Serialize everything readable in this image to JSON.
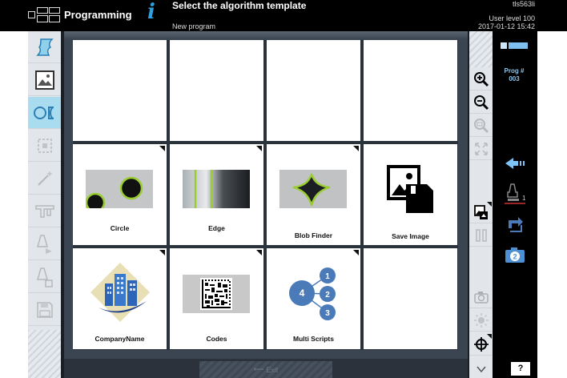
{
  "header": {
    "app_title": "Programming",
    "page_title": "Select the algorithm template",
    "page_subtitle": "New program",
    "device_name": "tls563li",
    "user_level": "User level 100",
    "datetime": "2017-01-12 15:42",
    "info_icon": "i"
  },
  "left_toolbar": {
    "items": [
      {
        "name": "program-icon",
        "state": "normal"
      },
      {
        "name": "image-icon",
        "state": "normal"
      },
      {
        "name": "shape-tools-icon",
        "state": "active"
      },
      {
        "name": "region-icon",
        "state": "disabled"
      },
      {
        "name": "magic-wand-icon",
        "state": "disabled"
      },
      {
        "name": "caliper-icon",
        "state": "disabled"
      },
      {
        "name": "tool-flow-icon",
        "state": "disabled"
      },
      {
        "name": "tool-branch-icon",
        "state": "disabled"
      },
      {
        "name": "save-icon",
        "state": "disabled"
      }
    ]
  },
  "templates": [
    {
      "label": "",
      "icon": "",
      "has_menu": false
    },
    {
      "label": "",
      "icon": "",
      "has_menu": false
    },
    {
      "label": "",
      "icon": "",
      "has_menu": false
    },
    {
      "label": "",
      "icon": "",
      "has_menu": false
    },
    {
      "label": "Circle",
      "icon": "circle-template-icon",
      "has_menu": true
    },
    {
      "label": "Edge",
      "icon": "edge-template-icon",
      "has_menu": true
    },
    {
      "label": "Blob Finder",
      "icon": "blob-template-icon",
      "has_menu": true
    },
    {
      "label": "Save Image",
      "icon": "save-image-icon",
      "has_menu": false
    },
    {
      "label": "CompanyName",
      "icon": "company-logo-icon",
      "has_menu": true
    },
    {
      "label": "Codes",
      "icon": "datamatrix-icon",
      "has_menu": true
    },
    {
      "label": "Multi Scripts",
      "icon": "multi-scripts-icon",
      "has_menu": true
    },
    {
      "label": "",
      "icon": "",
      "has_menu": false
    }
  ],
  "multi_scripts_numbers": [
    "4",
    "1",
    "2",
    "3"
  ],
  "bottom": {
    "exit_label": "Exit"
  },
  "right_toolbar": {
    "items": [
      "zoom-in-icon",
      "zoom-out-icon",
      "zoom-fit-icon",
      "fullscreen-icon",
      "image-swap-icon",
      "pause-icon",
      "camera-settings-icon",
      "brightness-icon",
      "crosshair-icon",
      "scroll-down-icon"
    ]
  },
  "far_right": {
    "prog_label": "Prog #",
    "prog_number": "003",
    "trigger_count": "1",
    "camera_number": "2",
    "help_label": "?"
  },
  "colors": {
    "accent": "#2f9fe0",
    "active_tool": "#a9dcef",
    "frame": "#3b4552",
    "highlight_green": "#9acd32",
    "logo_blue": "#2d66b8"
  }
}
